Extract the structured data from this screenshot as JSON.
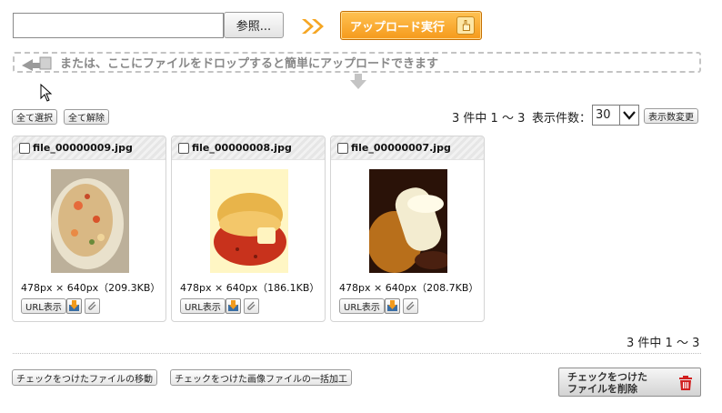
{
  "upload": {
    "file_value": "",
    "browse_label": "参照...",
    "submit_label": "アップロード実行"
  },
  "dropzone": {
    "text": "または、ここにファイルをドロップすると簡単にアップロードできます"
  },
  "toolbar": {
    "select_all": "全て選択",
    "deselect_all": "全て解除",
    "count_text": "3 件中 1 ～ 3",
    "per_page_label": "表示件数：",
    "per_page_value": "30",
    "per_page_button": "表示数変更"
  },
  "files": [
    {
      "name": "file_00000009.jpg",
      "dims": "478px × 640px（209.3KB）",
      "url_button": "URL表示",
      "checked": false
    },
    {
      "name": "file_00000008.jpg",
      "dims": "478px × 640px（186.1KB）",
      "url_button": "URL表示",
      "checked": false
    },
    {
      "name": "file_00000007.jpg",
      "dims": "478px × 640px（208.7KB）",
      "url_button": "URL表示",
      "checked": false
    }
  ],
  "footer": {
    "count_text": "3 件中 1 ～ 3",
    "move_checked": "チェックをつけたファイルの移動",
    "bulk_process": "チェックをつけた画像ファイルの一括加工",
    "delete_line1": "チェックをつけた",
    "delete_line2": "ファイルを削除"
  },
  "colors": {
    "upload_accent": "#f59a1b",
    "delete_icon": "#d11f1f"
  },
  "icons": {
    "arrow": "double-chevron-right-icon",
    "upload": "hand-pointer-icon",
    "drop": "arrow-to-tray-icon",
    "download": "download-icon",
    "attach": "paperclip-icon",
    "trash": "trash-icon"
  }
}
